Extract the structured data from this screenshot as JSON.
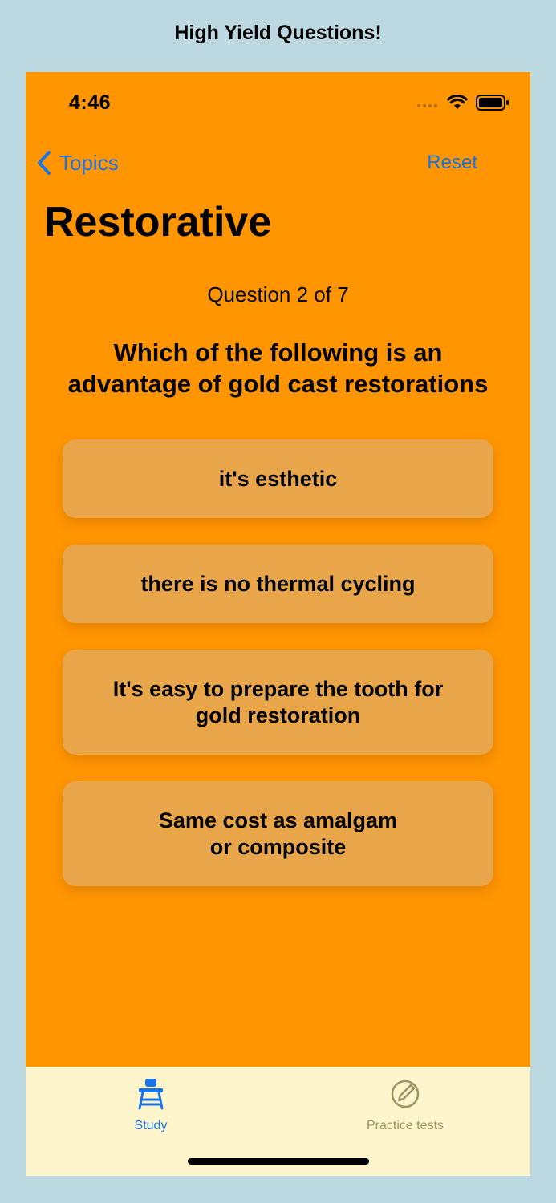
{
  "app": {
    "title": "High Yield Questions!"
  },
  "status_bar": {
    "time": "4:46",
    "icons": [
      "signal-icon",
      "wifi-icon",
      "battery-icon"
    ]
  },
  "nav": {
    "back_label": "Topics",
    "back_icon": "chevron-left-icon",
    "reset_label": "Reset"
  },
  "page": {
    "title": "Restorative"
  },
  "quiz": {
    "counter": "Question 2 of 7",
    "question": "Which of the following is an advantage of gold cast restorations",
    "answers": [
      {
        "label": "it's esthetic"
      },
      {
        "label": "there is no thermal cycling"
      },
      {
        "label": "It's easy to prepare the tooth for\ngold restoration"
      },
      {
        "label": "Same cost as amalgam\nor composite"
      }
    ]
  },
  "tabs": [
    {
      "label": "Study",
      "icon": "school-desk-icon",
      "selected": true
    },
    {
      "label": "Practice tests",
      "icon": "pencil-circle-icon",
      "selected": false
    }
  ],
  "colors": {
    "background": "#bcd9e1",
    "screen": "#ff9500",
    "answer": "#e8a54a",
    "tab_bar": "#fff5cc",
    "accent": "#1a73e8",
    "inactive_tab": "#9c9561"
  }
}
